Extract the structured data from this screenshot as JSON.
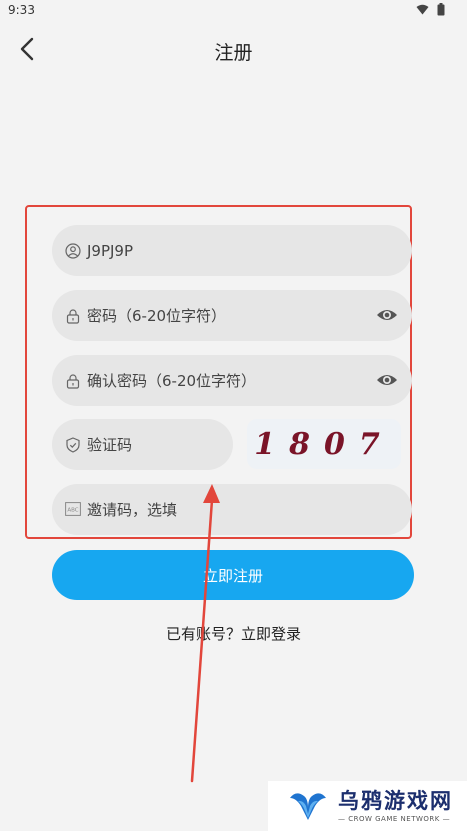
{
  "status": {
    "time": "9:33"
  },
  "header": {
    "title": "注册"
  },
  "form": {
    "username": {
      "value": "J9PJ9P"
    },
    "password": {
      "placeholder": "密码（6-20位字符）"
    },
    "confirm_password": {
      "placeholder": "确认密码（6-20位字符）"
    },
    "captcha_input": {
      "placeholder": "验证码"
    },
    "captcha_image": {
      "text": "1807"
    },
    "invite_code": {
      "placeholder": "邀请码，选填",
      "icon_text": "ABC"
    }
  },
  "actions": {
    "register_label": "立即注册",
    "login_link": "已有账号？立即登录"
  },
  "watermark": {
    "title": "乌鸦游戏网",
    "subtitle": "— CROW GAME NETWORK —"
  },
  "colors": {
    "primary": "#17a7f0",
    "annotation": "#e2463b",
    "background": "#f3f3f3",
    "field": "#e6e6e6"
  }
}
